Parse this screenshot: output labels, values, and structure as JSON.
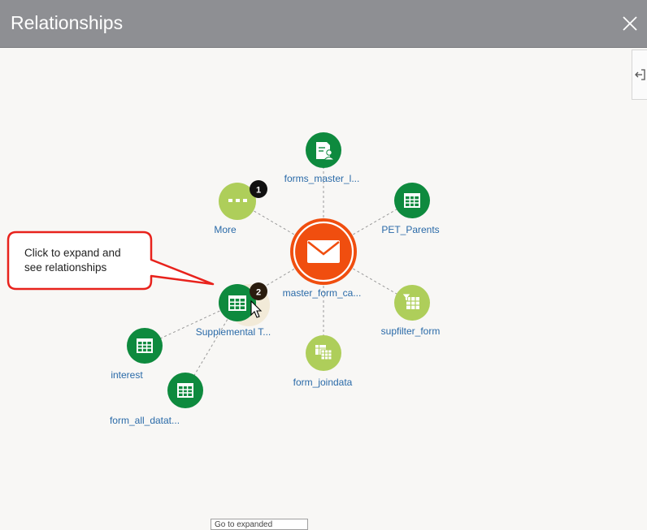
{
  "header": {
    "title": "Relationships",
    "close_icon": "close-icon"
  },
  "side_tab": {
    "icon": "collapse-panel-icon"
  },
  "center_node": {
    "label": "master_form_ca...",
    "icon": "envelope-icon",
    "color": "#f04e0f"
  },
  "nodes": [
    {
      "key": "forms_master",
      "label": "forms_master_l...",
      "icon": "form-document-icon",
      "color": "#0e8a3e"
    },
    {
      "key": "more",
      "label": "More",
      "icon": "ellipsis-icon",
      "color": "#aece5a",
      "badge": "1"
    },
    {
      "key": "pet_parents",
      "label": "PET_Parents",
      "icon": "table-icon",
      "color": "#0e8a3e"
    },
    {
      "key": "supplemental",
      "label": "Supplemental T...",
      "icon": "table-icon",
      "color": "#0e8a3e",
      "badge": "2"
    },
    {
      "key": "supfilter",
      "label": "supfilter_form",
      "icon": "filter-table-icon",
      "color": "#aece5a"
    },
    {
      "key": "form_joindata",
      "label": "form_joindata",
      "icon": "joined-tables-icon",
      "color": "#aece5a"
    },
    {
      "key": "interest",
      "label": "interest",
      "icon": "table-icon",
      "color": "#0e8a3e"
    },
    {
      "key": "form_all_data",
      "label": "form_all_datat...",
      "icon": "table-icon",
      "color": "#0e8a3e"
    }
  ],
  "callout": {
    "text_line1": "Click to expand and",
    "text_line2": "see relationships",
    "border_color": "#e8221c"
  },
  "bottom_partial_text": "Go to expanded"
}
